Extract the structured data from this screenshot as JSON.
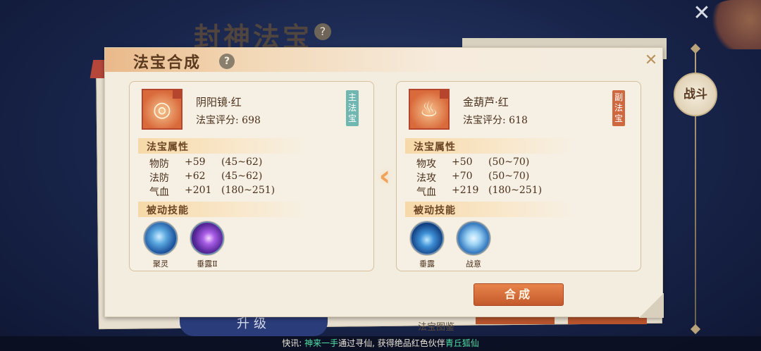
{
  "background": {
    "title": "封神法宝",
    "help_icon": "?",
    "close_icon": "✕",
    "battle_button": "战斗",
    "upgrade_button": "升级",
    "catalog_link": "法宝图鉴"
  },
  "modal": {
    "title": "法宝合成",
    "help_icon": "?",
    "close_icon": "✕",
    "arrow_icon": "‹",
    "compose_button": "合成"
  },
  "main_treasure": {
    "tag": "主法宝",
    "name": "阴阳镜·红",
    "score": "法宝评分: 698",
    "attr_section": "法宝属性",
    "attributes": [
      {
        "name": "物防",
        "value": "+59",
        "range": "(45~62)"
      },
      {
        "name": "法防",
        "value": "+62",
        "range": "(45~62)"
      },
      {
        "name": "气血",
        "value": "+201",
        "range": "(180~251)"
      }
    ],
    "skill_section": "被动技能",
    "skills": [
      {
        "name": "聚灵",
        "icon": "swirl-skill-icon"
      },
      {
        "name": "垂露Ⅱ",
        "icon": "dewdrop-purple-skill-icon"
      }
    ]
  },
  "sub_treasure": {
    "tag": "副法宝",
    "name": "金葫芦·红",
    "score": "法宝评分: 618",
    "attr_section": "法宝属性",
    "attributes": [
      {
        "name": "物攻",
        "value": "+50",
        "range": "(50~70)"
      },
      {
        "name": "法攻",
        "value": "+70",
        "range": "(50~70)"
      },
      {
        "name": "气血",
        "value": "+219",
        "range": "(180~251)"
      }
    ],
    "skill_section": "被动技能",
    "skills": [
      {
        "name": "垂露",
        "icon": "dewdrop-blue-skill-icon"
      },
      {
        "name": "战意",
        "icon": "war-spirit-skill-icon"
      }
    ]
  },
  "ticker": {
    "prefix": "快讯: ",
    "player": "神来一手",
    "middle": "通过寻仙, 获得绝品红色伙伴",
    "partner": "青丘狐仙"
  },
  "colors": {
    "accent_orange": "#c45a2b",
    "main_tag": "#6fb7b0",
    "sub_tag": "#d0683f",
    "ticker_highlight": "#4fe0a6"
  }
}
